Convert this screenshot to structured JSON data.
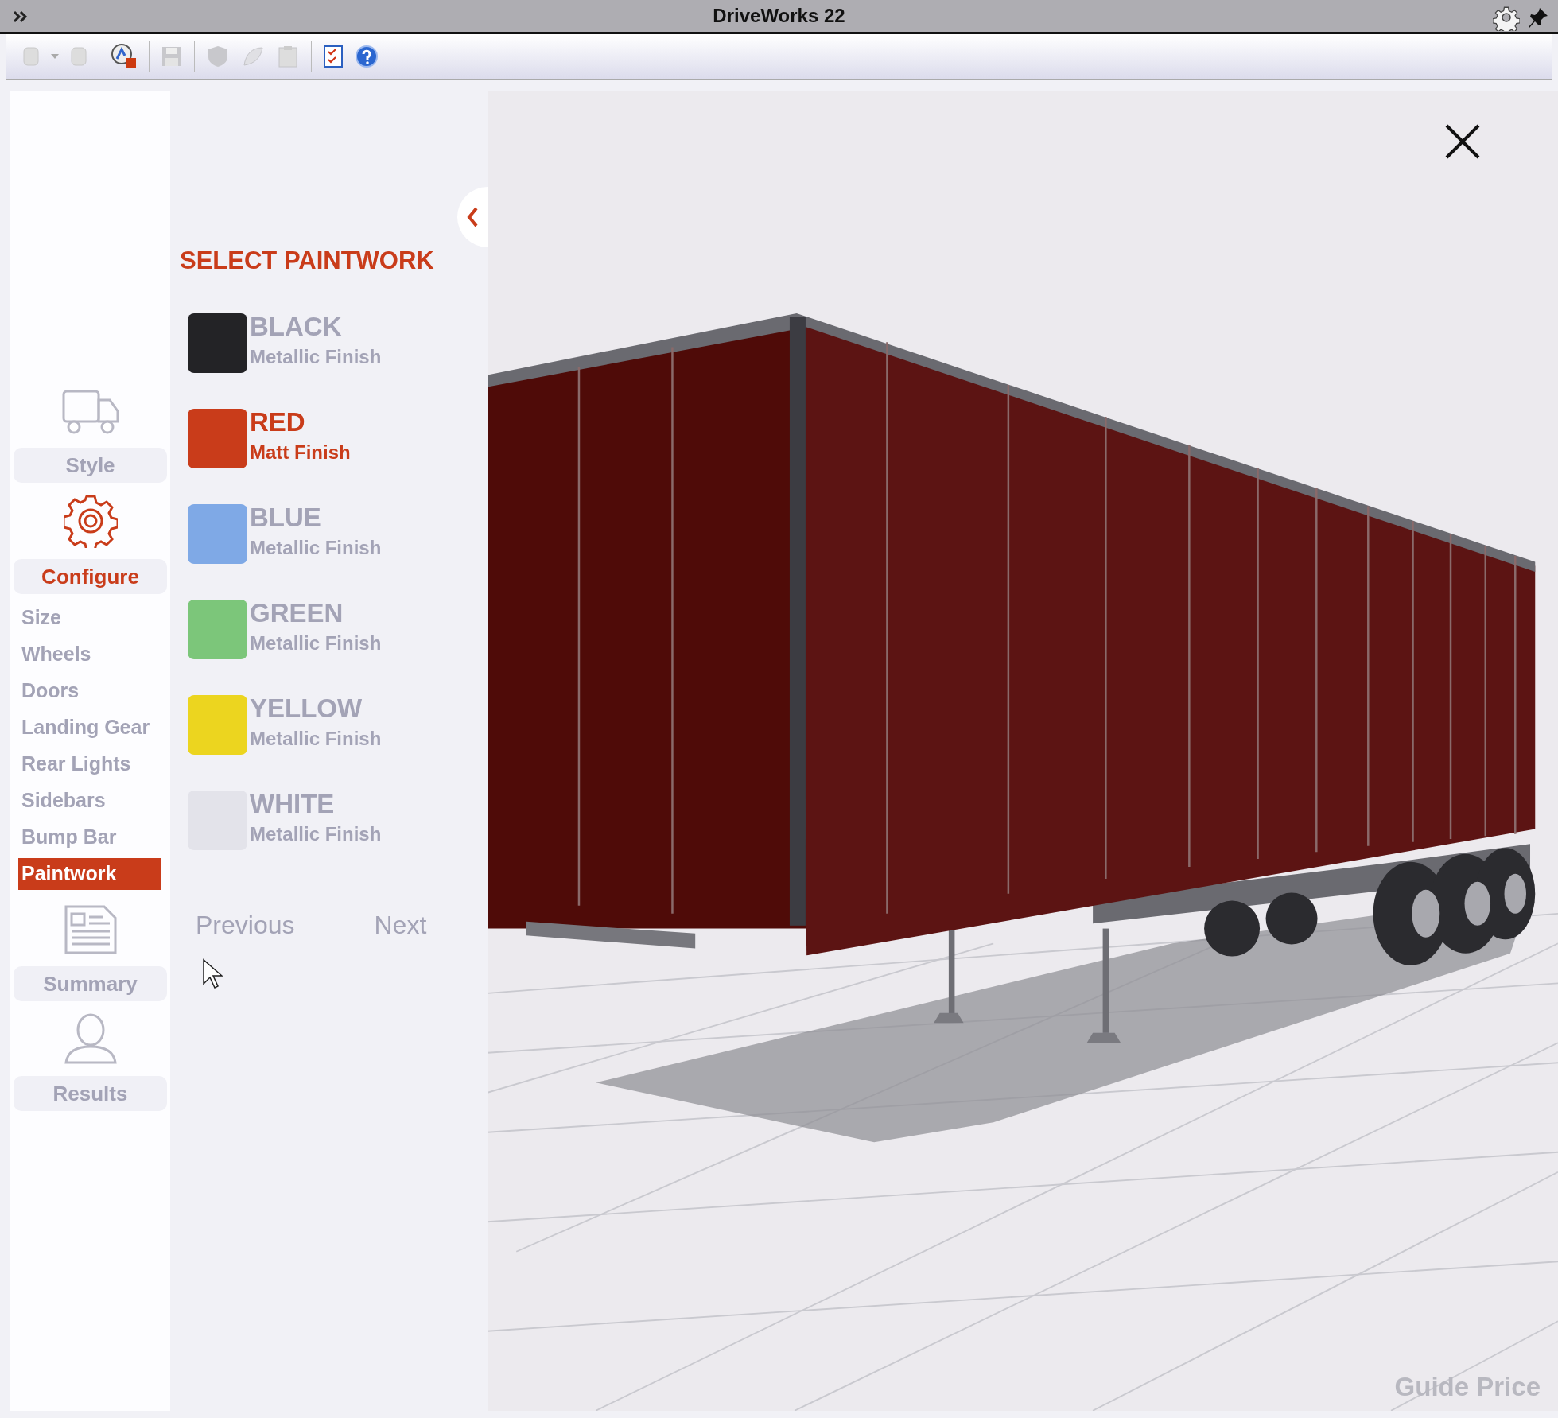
{
  "window": {
    "title": "DriveWorks 22"
  },
  "sidebar": {
    "sections": [
      {
        "kind": "truck",
        "label": "Style",
        "selected": false
      },
      {
        "kind": "gear",
        "label": "Configure",
        "selected": true,
        "children": [
          {
            "label": "Size",
            "selected": false
          },
          {
            "label": "Wheels",
            "selected": false
          },
          {
            "label": "Doors",
            "selected": false
          },
          {
            "label": "Landing Gear",
            "selected": false
          },
          {
            "label": "Rear Lights",
            "selected": false
          },
          {
            "label": "Sidebars",
            "selected": false
          },
          {
            "label": "Bump Bar",
            "selected": false
          },
          {
            "label": "Paintwork",
            "selected": true
          }
        ]
      },
      {
        "kind": "document",
        "label": "Summary",
        "selected": false
      },
      {
        "kind": "person",
        "label": "Results",
        "selected": false
      }
    ]
  },
  "panel": {
    "heading": "SELECT PAINTWORK",
    "options": [
      {
        "name": "BLACK",
        "finish": "Metallic Finish",
        "color": "#232326",
        "selected": false
      },
      {
        "name": "RED",
        "finish": "Matt Finish",
        "color": "#c93c1a",
        "selected": true
      },
      {
        "name": "BLUE",
        "finish": "Metallic Finish",
        "color": "#7fa9e6",
        "selected": false
      },
      {
        "name": "GREEN",
        "finish": "Metallic Finish",
        "color": "#7cc67a",
        "selected": false
      },
      {
        "name": "YELLOW",
        "finish": "Metallic Finish",
        "color": "#ecd51f",
        "selected": false
      },
      {
        "name": "WHITE",
        "finish": "Metallic Finish",
        "color": "#e3e3ea",
        "selected": false
      }
    ],
    "buttons": [
      "Previous",
      "Next"
    ]
  },
  "viewer": {
    "guide_price": "Guide Price"
  }
}
